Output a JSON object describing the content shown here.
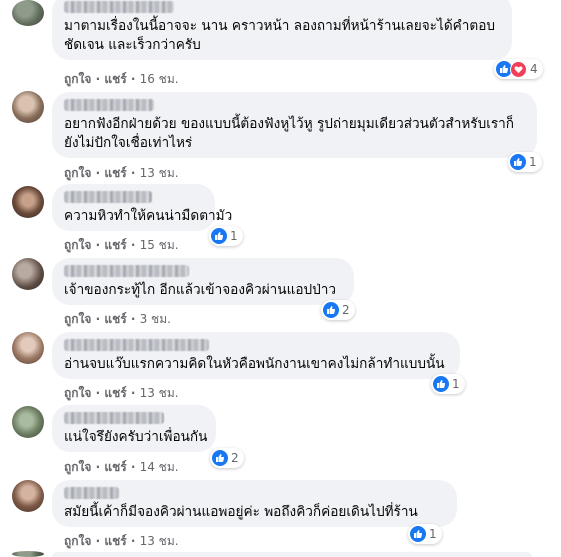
{
  "comments": [
    {
      "text_lines": [
        "มาตามเรื่องในนี้อาจจะ นาน คราวหน้า ลองถามที่หน้าร้านเลยจะได้คำตอบ",
        "ชัดเจน และเร็วกว่าครับ"
      ],
      "like": "ถูกใจ",
      "reply": "แชร์",
      "time": "16 ชม.",
      "reactions": [
        "like",
        "love"
      ],
      "reaction_count": "4"
    },
    {
      "text_lines": [
        "อยากฟังอีกฝ่ายด้วย ของแบบนี้ต้องฟังหูไว้หู รูปถ่ายมุมเดียวส่วนตัวสำหรับเราก็",
        "ยังไม่ปักใจเชื่อเท่าไหร่"
      ],
      "like": "ถูกใจ",
      "reply": "แชร์",
      "time": "13 ชม.",
      "reactions": [
        "like"
      ],
      "reaction_count": "1"
    },
    {
      "text_lines": [
        "ความหิวทำให้คนน่ามืดตามัว"
      ],
      "like": "ถูกใจ",
      "reply": "แชร์",
      "time": "15 ชม.",
      "reactions": [
        "like"
      ],
      "reaction_count": "1"
    },
    {
      "text_lines": [
        "เจ้าของกระทู้ไก อีกแล้วเข้าจองคิวผ่านแอปป่าว"
      ],
      "like": "ถูกใจ",
      "reply": "แชร์",
      "time": "3 ชม.",
      "reactions": [
        "like"
      ],
      "reaction_count": "2"
    },
    {
      "text_lines": [
        "อ่านจบแว๊บแรกความคิดในหัวคือพนักงานเขาคงไม่กล้าทำแบบนั้น"
      ],
      "like": "ถูกใจ",
      "reply": "แชร์",
      "time": "13 ชม.",
      "reactions": [
        "like"
      ],
      "reaction_count": "1"
    },
    {
      "text_lines": [
        "แน่ใจรึยังครับว่าเพื่อนกัน"
      ],
      "like": "ถูกใจ",
      "reply": "แชร์",
      "time": "14 ชม.",
      "reactions": [
        "like"
      ],
      "reaction_count": "2"
    },
    {
      "text_lines": [
        "สมัยนี้เค้าก็มีจองคิวผ่านแอพอยู่ค่ะ พอถึงคิวก็ค่อยเดินไปที่ร้าน"
      ],
      "like": "ถูกใจ",
      "reply": "แชร์",
      "time": "13 ชม.",
      "reactions": [
        "like"
      ],
      "reaction_count": "1"
    }
  ],
  "colors": {
    "bubble": "#f0f2f5",
    "like_blue": "#1877f2",
    "love_red": "#f33e58",
    "meta_gray": "#65676b"
  }
}
